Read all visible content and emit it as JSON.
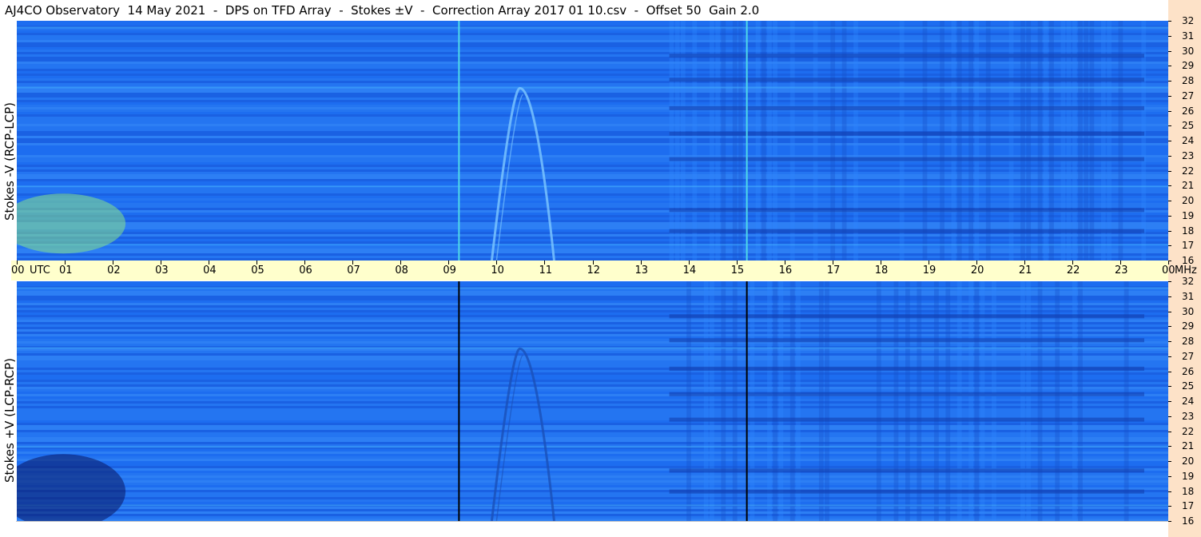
{
  "title": "AJ4CO Observatory  14 May 2021  -  DPS on TFD Array  -  Stokes ±V  -  Correction Array 2017 01 10.csv  -  Offset 50  Gain 2.0",
  "colors": {
    "background": "#1e6ef0",
    "axis_band": "#ffffcc",
    "right_strip": "#fde2c8"
  },
  "chart_data": [
    {
      "type": "heatmap",
      "ylabel": "Stokes -V (RCP-LCP)",
      "x_unit": "UTC",
      "y_unit": "MHz",
      "xlim": [
        0,
        24
      ],
      "ylim": [
        16,
        32
      ],
      "x_ticks": [
        "00",
        "01",
        "02",
        "03",
        "04",
        "05",
        "06",
        "07",
        "08",
        "09",
        "10",
        "11",
        "12",
        "13",
        "14",
        "15",
        "16",
        "17",
        "18",
        "19",
        "20",
        "21",
        "22",
        "23",
        "00"
      ],
      "y_ticks": [
        "16",
        "17",
        "18",
        "19",
        "20",
        "21",
        "22",
        "23",
        "24",
        "25",
        "26",
        "27",
        "28",
        "29",
        "30",
        "31",
        "32"
      ],
      "vertical_lines_utc": [
        9.2,
        15.2
      ],
      "vertical_line_color": "#4fd8e8",
      "features": [
        {
          "kind": "patch",
          "utc": [
            0,
            2.6
          ],
          "mhz": [
            17,
            21
          ],
          "color": "#86e08a"
        },
        {
          "kind": "arc",
          "utc": [
            9.9,
            11.2
          ],
          "mhz": [
            16,
            27.5
          ],
          "color": "#7ec8ff"
        }
      ]
    },
    {
      "type": "heatmap",
      "ylabel": "Stokes +V (LCP-RCP)",
      "x_unit": "UTC",
      "y_unit": "MHz",
      "xlim": [
        0,
        24
      ],
      "ylim": [
        16,
        32
      ],
      "x_ticks": [
        "00",
        "01",
        "02",
        "03",
        "04",
        "05",
        "06",
        "07",
        "08",
        "09",
        "10",
        "11",
        "12",
        "13",
        "14",
        "15",
        "16",
        "17",
        "18",
        "19",
        "20",
        "21",
        "22",
        "23",
        "00"
      ],
      "y_ticks": [
        "16",
        "17",
        "18",
        "19",
        "20",
        "21",
        "22",
        "23",
        "24",
        "25",
        "26",
        "27",
        "28",
        "29",
        "30",
        "31",
        "32"
      ],
      "vertical_lines_utc": [
        9.2,
        15.2
      ],
      "vertical_line_color": "#000000",
      "features": [
        {
          "kind": "patch",
          "utc": [
            0,
            2.6
          ],
          "mhz": [
            16,
            21
          ],
          "color": "#0a1660"
        },
        {
          "kind": "arc",
          "utc": [
            9.9,
            11.2
          ],
          "mhz": [
            16,
            27.5
          ],
          "color": "#1a50b8"
        }
      ]
    }
  ]
}
